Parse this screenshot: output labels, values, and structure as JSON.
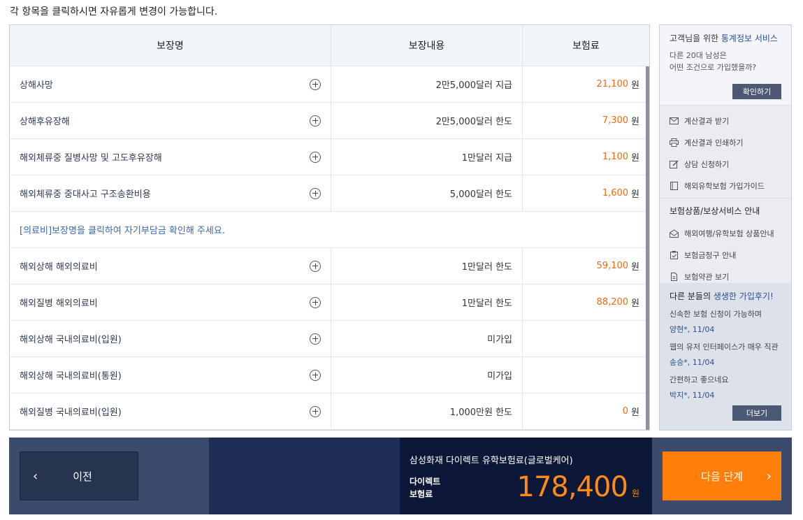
{
  "instruction": "각 항목을 클릭하시면 자유롭게 변경이 가능합니다.",
  "table": {
    "headers": {
      "name": "보장명",
      "content": "보장내용",
      "premium": "보험료"
    },
    "currency": "원",
    "rows_top": [
      {
        "name": "상해사망",
        "content": "2만5,000달러 지급",
        "premium": "21,100"
      },
      {
        "name": "상해후유장해",
        "content": "2만5,000달러 한도",
        "premium": "7,300"
      },
      {
        "name": "해외체류중 질병사망 및 고도후유장해",
        "content": "1만달러 지급",
        "premium": "1,100"
      },
      {
        "name": "해외체류중 중대사고 구조송환비용",
        "content": "5,000달러 한도",
        "premium": "1,600"
      }
    ],
    "notice": "[의료비]보장명을 클릭하여 자기부담금 확인해 주세요.",
    "rows_medical": [
      {
        "name": "해외상해 해외의료비",
        "content": "1만달러 한도",
        "premium": "59,100"
      },
      {
        "name": "해외질병 해외의료비",
        "content": "1만달러 한도",
        "premium": "88,200"
      },
      {
        "name": "해외상해 국내의료비(입원)",
        "content": "미가입",
        "premium": ""
      },
      {
        "name": "해외상해 국내의료비(통원)",
        "content": "미가입",
        "premium": ""
      },
      {
        "name": "해외질병 국내의료비(입원)",
        "content": "1,000만원 한도",
        "premium": "0"
      }
    ]
  },
  "side": {
    "stats_title_prefix": "고객님을 위한 ",
    "stats_title_highlight": "통계정보 서비스",
    "stats_desc_1": "다른 20대 남성은",
    "stats_desc_2": "어떤 조건으로 가입했을까?",
    "confirm_label": "확인하기",
    "actions": [
      {
        "label": "계산결과 받기",
        "icon": "mail-icon"
      },
      {
        "label": "계산결과 인쇄하기",
        "icon": "print-icon"
      },
      {
        "label": "상담 신청하기",
        "icon": "edit-icon"
      },
      {
        "label": "해외유학보험 가입가이드",
        "icon": "book-icon"
      }
    ],
    "services_title": "보험상품/보상서비스 안내",
    "services": [
      {
        "label": "해외여행/유학보험 상품안내",
        "icon": "open-mail-icon"
      },
      {
        "label": "보험금청구 안내",
        "icon": "clipboard-icon"
      },
      {
        "label": "보험약관 보기",
        "icon": "document-icon"
      }
    ],
    "reviews_title_prefix": "다른 분들의 ",
    "reviews_title_highlight": "생생한 가입후기!",
    "reviews": [
      {
        "text": "신속한 보험 신청이 가능하며",
        "meta": "양현*, 11/04"
      },
      {
        "text": "웹의 유저 인터페이스가 매우 직관",
        "meta": "송승*, 11/04"
      },
      {
        "text": "간편하고 좋으네요",
        "meta": "박지*, 11/04"
      }
    ],
    "more_label": "더보기"
  },
  "bottom": {
    "prev_label": "이전",
    "product_name": "삼성화재 다이렉트 유학보험료(글로벌케어)",
    "total_label_1": "다이렉트",
    "total_label_2": "보험료",
    "total_amount": "178,400",
    "total_unit": "원",
    "next_label": "다음 단계"
  },
  "colors": {
    "premium_orange": "#f06a0f",
    "next_button": "#ff7f0a",
    "bottom_dark": "#0d1838",
    "accent_blue": "#2e4f8f"
  }
}
